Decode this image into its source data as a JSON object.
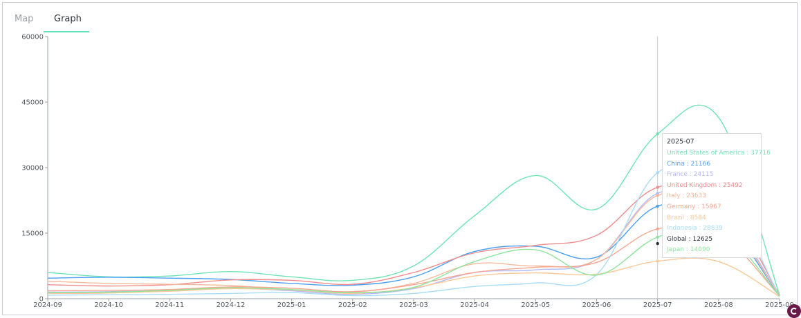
{
  "tabs": [
    {
      "label": "Map",
      "active": false
    },
    {
      "label": "Graph",
      "active": true
    }
  ],
  "chart_data": {
    "type": "line",
    "title": "",
    "xlabel": "",
    "ylabel": "",
    "categories": [
      "2024-09",
      "2024-10",
      "2024-11",
      "2024-12",
      "2025-01",
      "2025-02",
      "2025-03",
      "2025-04",
      "2025-05",
      "2025-06",
      "2025-07",
      "2025-08",
      "2025-09"
    ],
    "ylim": [
      0,
      60000
    ],
    "yticks": [
      "0",
      "15000",
      "30000",
      "45000",
      "60000"
    ],
    "grid": false,
    "hover_category": "2025-07",
    "series": [
      {
        "name": "United States of America",
        "color": "#6fe3b4",
        "values": [
          6000,
          5000,
          5200,
          6200,
          5000,
          4200,
          7500,
          19000,
          28200,
          20500,
          37716,
          41500,
          800
        ]
      },
      {
        "name": "China",
        "color": "#4a9ff5",
        "values": [
          4700,
          4900,
          4700,
          4400,
          3500,
          3100,
          5000,
          10800,
          12000,
          9500,
          21166,
          19000,
          600
        ]
      },
      {
        "name": "France",
        "color": "#b3b8f7",
        "values": [
          1500,
          1600,
          1900,
          2400,
          1800,
          1000,
          2300,
          6000,
          6600,
          9000,
          24115,
          21000,
          700
        ]
      },
      {
        "name": "United Kingdom",
        "color": "#f28b8b",
        "values": [
          3200,
          2900,
          3200,
          4300,
          4200,
          3300,
          6000,
          10500,
          12200,
          14500,
          25492,
          23500,
          800
        ]
      },
      {
        "name": "Italy",
        "color": "#f5b99c",
        "values": [
          4000,
          3500,
          3300,
          3000,
          2000,
          1600,
          3500,
          8000,
          7500,
          9000,
          23633,
          20000,
          700
        ]
      },
      {
        "name": "Germany",
        "color": "#f7a58f",
        "values": [
          1800,
          1900,
          2100,
          2700,
          2400,
          1600,
          3200,
          6000,
          7200,
          8300,
          15967,
          15000,
          600
        ]
      },
      {
        "name": "Brazil",
        "color": "#fbc896",
        "values": [
          1200,
          1300,
          1700,
          2300,
          2000,
          1200,
          2500,
          5200,
          5900,
          5600,
          8584,
          8500,
          500
        ]
      },
      {
        "name": "Indonesia",
        "color": "#a8dcf7",
        "values": [
          800,
          900,
          1000,
          1200,
          1400,
          700,
          1200,
          2800,
          3600,
          5500,
          28839,
          26000,
          500
        ]
      },
      {
        "name": "Global",
        "color": "#2b2f36",
        "values": [
          null,
          null,
          null,
          null,
          null,
          null,
          null,
          null,
          null,
          null,
          12625,
          null,
          null
        ]
      },
      {
        "name": "Japan",
        "color": "#8ce59c",
        "values": [
          1400,
          1500,
          1900,
          2500,
          2100,
          1400,
          2600,
          8500,
          11200,
          5400,
          14090,
          16000,
          600
        ]
      }
    ],
    "tooltip": {
      "title": "2025-07",
      "rows": [
        {
          "label": "United States of America : 37716",
          "color": "#6fe3b4"
        },
        {
          "label": "China : 21166",
          "color": "#4a9ff5"
        },
        {
          "label": "France : 24115",
          "color": "#b3b8f7"
        },
        {
          "label": "United Kingdom : 25492",
          "color": "#f28b8b"
        },
        {
          "label": "Italy : 23633",
          "color": "#f5b99c"
        },
        {
          "label": "Germany : 15967",
          "color": "#f7a58f"
        },
        {
          "label": "Brazil : 8584",
          "color": "#fbc896"
        },
        {
          "label": "Indonesia : 28839",
          "color": "#a8dcf7"
        },
        {
          "label": "Global : 12625",
          "color": "#2b2f36"
        },
        {
          "label": "Japan : 14090",
          "color": "#8ce59c"
        }
      ]
    }
  },
  "logo": {
    "name": "brand-logo"
  }
}
